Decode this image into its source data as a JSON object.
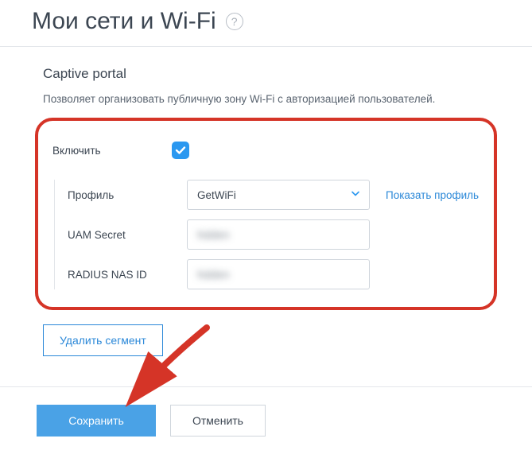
{
  "header": {
    "title": "Мои сети и Wi-Fi"
  },
  "section": {
    "title": "Captive portal",
    "description": "Позволяет организовать публичную зону Wi-Fi с авторизацией пользователей."
  },
  "form": {
    "enable_label": "Включить",
    "enabled": true,
    "profile_label": "Профиль",
    "profile_value": "GetWiFi",
    "show_profile_link": "Показать профиль",
    "uam_secret_label": "UAM Secret",
    "uam_secret_value": "hidden",
    "radius_nas_label": "RADIUS NAS ID",
    "radius_nas_value": "hidden"
  },
  "actions": {
    "delete_segment": "Удалить сегмент",
    "save": "Сохранить",
    "cancel": "Отменить"
  }
}
